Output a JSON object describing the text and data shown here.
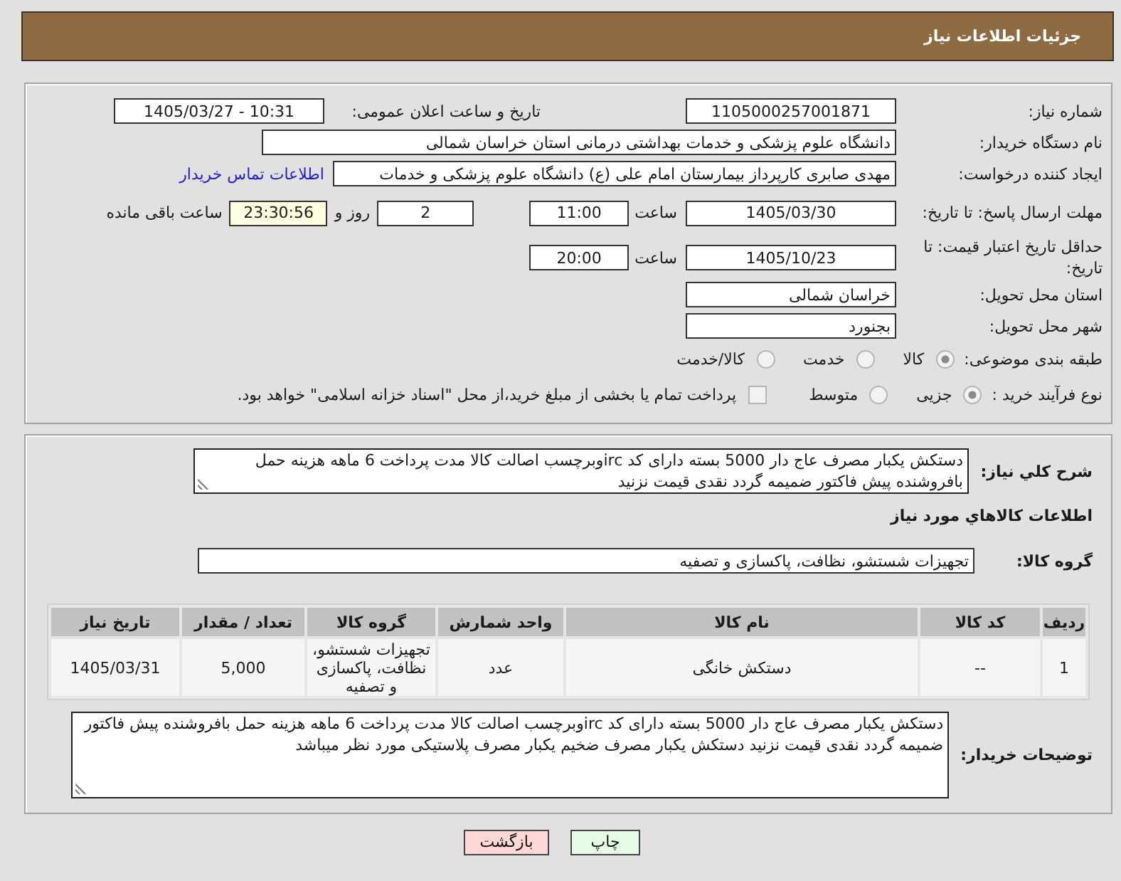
{
  "header": {
    "title": "جزئیات اطلاعات نیاز"
  },
  "details": {
    "need_number": {
      "label": "شماره نیاز:",
      "value": "1105000257001871"
    },
    "announce_datetime": {
      "label": "تاریخ و ساعت اعلان عمومی:",
      "value": "1405/03/27 - 10:31"
    },
    "buyer_org": {
      "label": "نام دستگاه خریدار:",
      "value": "دانشگاه علوم پزشکی و خدمات بهداشتی درمانی استان خراسان شمالی"
    },
    "requester": {
      "label": "ایجاد کننده درخواست:",
      "value": "مهدی صابری کارپرداز بیمارستان امام علی (ع) دانشگاه علوم پزشکی و خدمات",
      "link": "اطلاعات تماس خریدار"
    },
    "response_deadline": {
      "label": "مهلت ارسال پاسخ: تا تاریخ:",
      "date": "1405/03/30",
      "time_label": "ساعت",
      "time": "11:00",
      "days": "2",
      "days_label": "روز و",
      "remaining": "23:30:56",
      "remaining_label": "ساعت باقی مانده"
    },
    "price_validity": {
      "label": "حداقل تاریخ اعتبار قیمت: تا تاریخ:",
      "date": "1405/10/23",
      "time_label": "ساعت",
      "time": "20:00"
    },
    "delivery_province": {
      "label": "استان محل تحویل:",
      "value": "خراسان شمالی"
    },
    "delivery_city": {
      "label": "شهر محل تحویل:",
      "value": "بجنورد"
    },
    "classification": {
      "label": "طبقه بندی موضوعی:",
      "options": [
        {
          "label": "کالا",
          "selected": true
        },
        {
          "label": "خدمت",
          "selected": false
        },
        {
          "label": "کالا/خدمت",
          "selected": false
        }
      ]
    },
    "purchase_process": {
      "label": "نوع فرآیند خرید :",
      "options": [
        {
          "label": "جزیی",
          "selected": true
        },
        {
          "label": "متوسط",
          "selected": false
        }
      ],
      "treasury_payment": {
        "label": "پرداخت تمام یا بخشی از مبلغ خرید،از محل \"اسناد خزانه اسلامی\" خواهد بود.",
        "checked": false
      }
    }
  },
  "needs": {
    "description": {
      "label": "شرح کلي نیاز:",
      "value": "دستکش یکبار مصرف عاج دار 5000 بسته دارای کد ircوبرچسب اصالت کالا مدت پرداخت 6 ماهه هزینه حمل بافروشنده پیش فاکتور ضمیمه گردد نقدی قیمت نزنید"
    },
    "section_title": "اطلاعات کالاهاي مورد نیاز",
    "goods_group": {
      "label": "گروه کالا:",
      "value": "تجهیزات شستشو، نظافت، پاکسازی و تصفیه"
    },
    "table": {
      "columns": [
        "ردیف",
        "کد کالا",
        "نام کالا",
        "واحد شمارش",
        "گروه کالا",
        "تعداد / مقدار",
        "تاریخ نیاز"
      ],
      "rows": [
        [
          "1",
          "--",
          "دستکش خانگی",
          "عدد",
          "تجهیزات شستشو، نظافت، پاکسازی و تصفیه",
          "5,000",
          "1405/03/31"
        ]
      ]
    },
    "buyer_notes": {
      "label": "توضیحات خریدار:",
      "value": "دستکش یکبار مصرف عاج دار 5000 بسته دارای کد ircوبرچسب اصالت کالا مدت پرداخت 6 ماهه هزینه حمل بافروشنده پیش فاکتور ضمیمه گردد نقدی قیمت نزنید دستکش یکبار مصرف ضخیم یکبار مصرف پلاستیکی مورد نظر میباشد"
    }
  },
  "buttons": [
    {
      "label": "چاپ",
      "kind": "print"
    },
    {
      "label": "بازگشت",
      "kind": "back"
    }
  ]
}
